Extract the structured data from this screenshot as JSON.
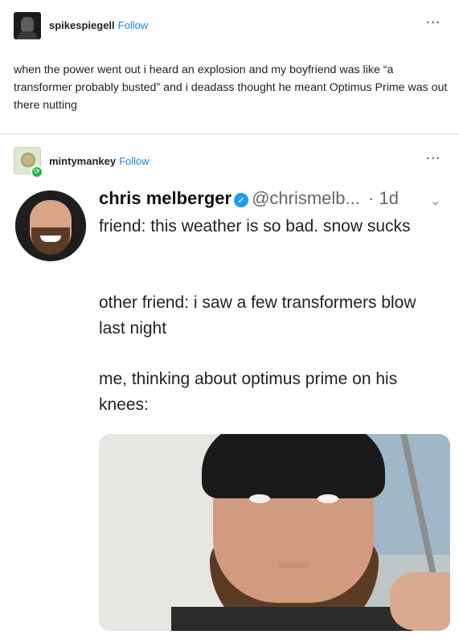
{
  "post1": {
    "username": "spikespiegell",
    "follow_label": "Follow",
    "more_label": "···",
    "body": "when the power went out i heard an explosion and my boyfriend was like “a transformer probably busted” and i deadass thought he meant Optimus Prime was out there nutting"
  },
  "post2": {
    "username": "mintymankey",
    "follow_label": "Follow",
    "more_label": "···",
    "reblog_icon": "reblog-icon"
  },
  "tweet": {
    "name": "chris melberger",
    "handle": "@chrismelb...",
    "time": "· 1d",
    "chevron": "⌄",
    "line1": "friend: this weather is so bad. snow sucks",
    "line2": "other friend: i saw a few transformers blow last night",
    "line3": "me, thinking about optimus prime on his knees:"
  },
  "colors": {
    "follow": "#1b84e8",
    "verified": "#1d9bf0",
    "reblog_badge": "#29b34a"
  }
}
